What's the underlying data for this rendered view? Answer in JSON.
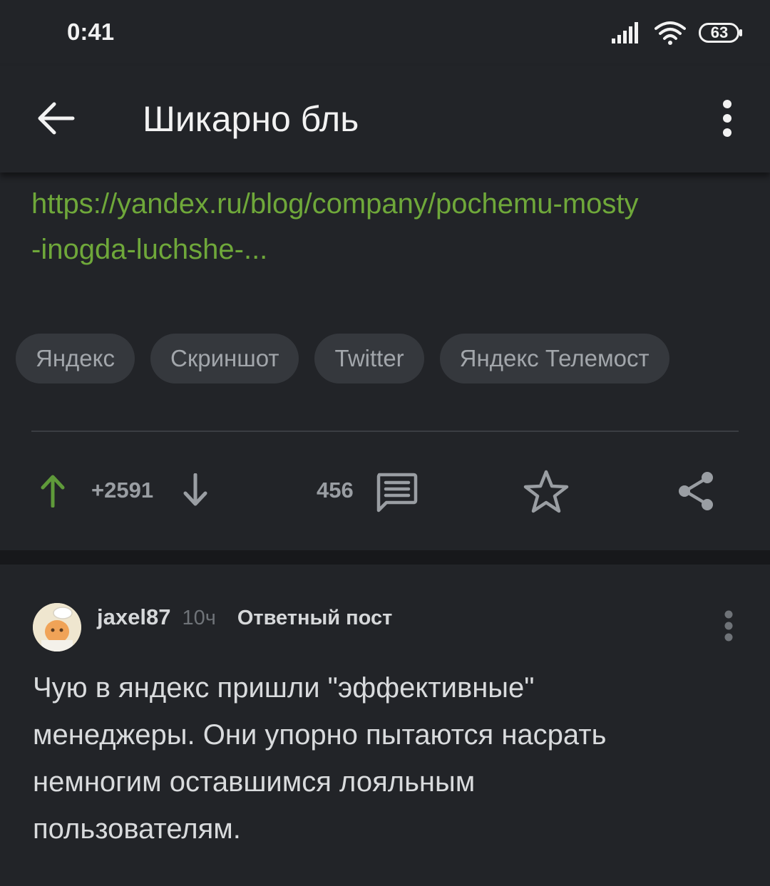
{
  "status_bar": {
    "time": "0:41",
    "battery": "63"
  },
  "header": {
    "title": "Шикарно бль"
  },
  "post": {
    "link_line1": "https://yandex.ru/blog/company/pochemu-mosty",
    "link_line2": "-inogda-luchshe-...",
    "tags": [
      "Яндекс",
      "Скриншот",
      "Twitter",
      "Яндекс Телемост"
    ],
    "rating": "+2591",
    "comments_count": "456"
  },
  "comment": {
    "author": "jaxel87",
    "time": "10ч",
    "type": "Ответный пост",
    "text_lines": [
      "Чую в яндекс пришли \"эффективные\"",
      "менеджеры. Они упорно пытаются насрать",
      "немногим оставшимся лояльным",
      "пользователям."
    ]
  },
  "colors": {
    "background": "#222428",
    "link": "#6fa83a",
    "upvote": "#5f9a3a",
    "tag_bg": "#35383d",
    "separator": "#17181b"
  },
  "icons": [
    "signal-icon",
    "wifi-icon",
    "battery-icon",
    "back-arrow-icon",
    "more-vert-icon",
    "upvote-arrow-icon",
    "downvote-arrow-icon",
    "comment-icon",
    "star-icon",
    "share-icon"
  ]
}
